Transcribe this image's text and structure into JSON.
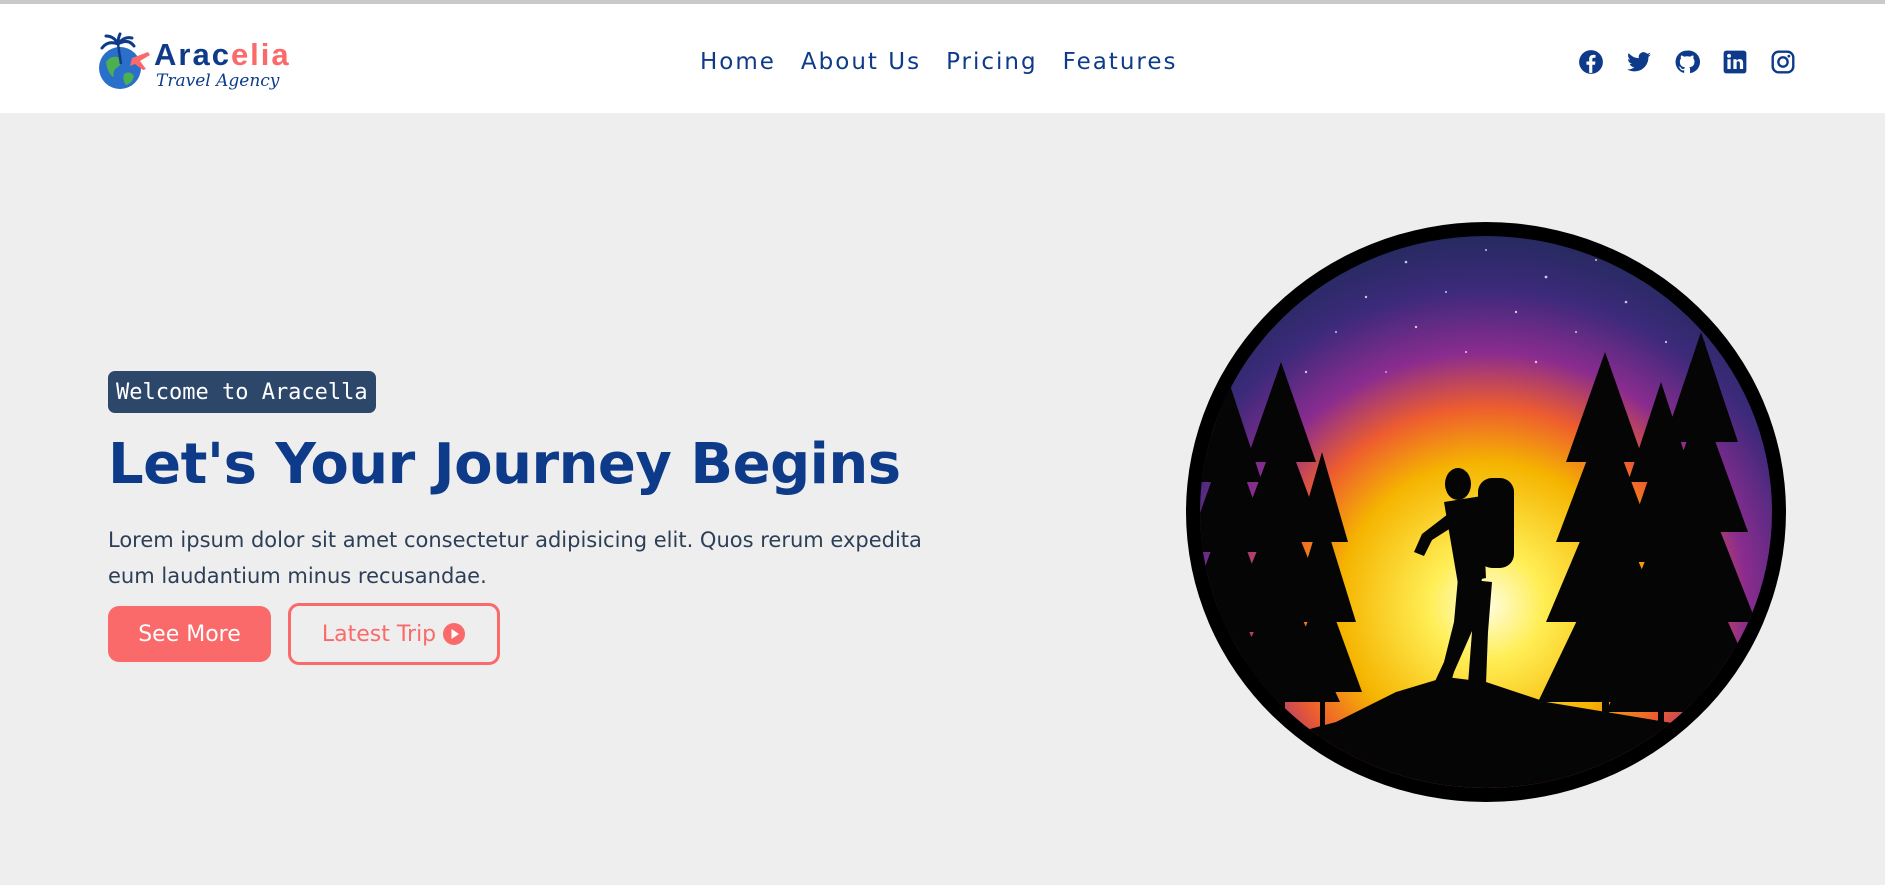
{
  "brand": {
    "name_part1": "Arac",
    "name_part2": "elia",
    "tagline": "Travel Agency"
  },
  "nav": {
    "items": [
      {
        "label": "Home"
      },
      {
        "label": "About Us"
      },
      {
        "label": "Pricing"
      },
      {
        "label": "Features"
      }
    ]
  },
  "socials": [
    "facebook-icon",
    "twitter-icon",
    "github-icon",
    "linkedin-icon",
    "instagram-icon"
  ],
  "hero": {
    "badge": "Welcome to Aracella",
    "title": "Let's Your Journey Begins",
    "description": "Lorem ipsum dolor sit amet consectetur adipisicing elit. Quos rerum expedita eum laudantium minus recusandae.",
    "primary_button": "See More",
    "secondary_button": "Latest Trip",
    "image_alt": "hiker-silhouette-illustration"
  },
  "colors": {
    "primary_blue": "#0d3b8a",
    "accent_coral": "#fa6a6a",
    "badge_bg": "#2d476b",
    "page_bg": "#eeeeee"
  }
}
